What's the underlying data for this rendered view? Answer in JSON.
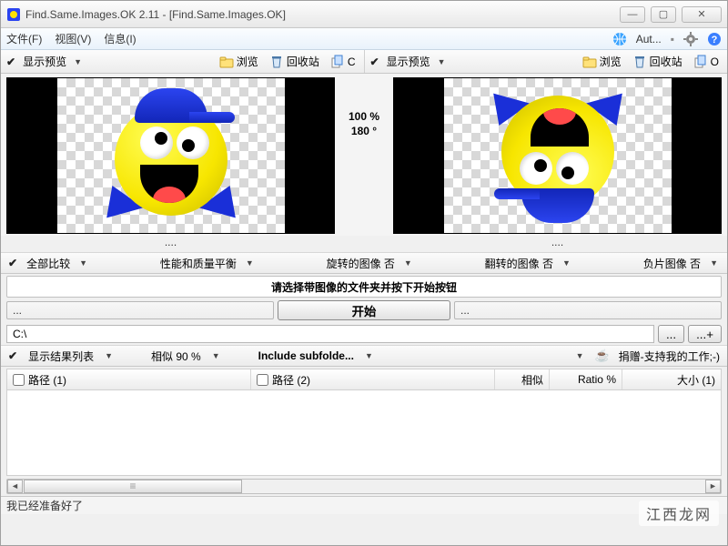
{
  "window": {
    "title": "Find.Same.Images.OK 2.11 - [Find.Same.Images.OK]"
  },
  "menu": {
    "file": "文件(F)",
    "view": "视图(V)",
    "info": "信息(I)",
    "auto": "Aut..."
  },
  "toolbar": {
    "show_preview": "显示预览",
    "browse": "浏览",
    "recycle_bin": "回收站",
    "c_btn": "C",
    "o_btn": "O"
  },
  "center": {
    "zoom": "100 %",
    "rotation": "180 °"
  },
  "file_row": {
    "left": "....",
    "right": "...."
  },
  "options": {
    "compare_all": "全部比较",
    "perf_quality": "性能和质量平衡",
    "rotated": "旋转的图像 否",
    "flipped": "翻转的图像 否",
    "negative": "负片图像 否"
  },
  "instruction": "请选择带图像的文件夹并按下开始按钮",
  "folder": {
    "left_placeholder": "...",
    "start": "开始",
    "right_placeholder": "..."
  },
  "path": {
    "value": "C:\\",
    "dots": "...",
    "dots_plus": "...+"
  },
  "filters": {
    "show_results": "显示结果列表",
    "similarity": "相似 90 %",
    "include_sub": "Include subfolde...",
    "donate": "捐赠-支持我的工作;-)"
  },
  "columns": {
    "path1": "路径 (1)",
    "path2": "路径 (2)",
    "similar": "相似",
    "ratio": "Ratio %",
    "size1": "大小 (1)"
  },
  "status": "我已经准备好了",
  "watermark": "江西龙网"
}
